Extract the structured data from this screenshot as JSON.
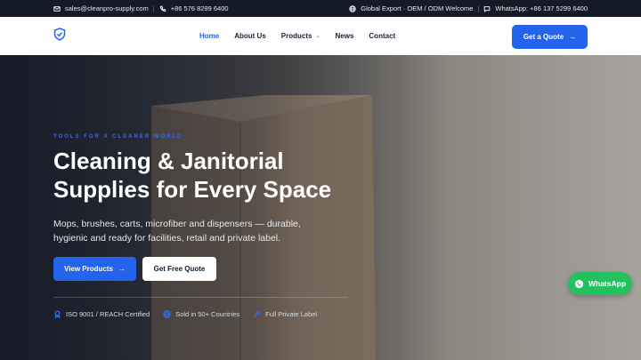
{
  "topbar": {
    "email": "sales@cleanpro-supply.com",
    "separator": "|",
    "phone": "+86 576 8299 6400",
    "export_note": "Global Export · OEM / ODM Welcome",
    "whatsapp": "WhatsApp: +86 137 5299 6400"
  },
  "nav": {
    "items": [
      {
        "label": "Home",
        "active": true
      },
      {
        "label": "About Us"
      },
      {
        "label": "Products",
        "has_dropdown": true
      },
      {
        "label": "News"
      },
      {
        "label": "Contact"
      }
    ],
    "cta": "Get a Quote"
  },
  "hero": {
    "eyebrow": "TOOLS FOR A CLEANER WORLD",
    "title_line1": "Cleaning & Janitorial",
    "title_line2": "Supplies for Every Space",
    "subtitle": "Mops, brushes, carts, microfiber and dispensers — durable, hygienic and ready for facilities, retail and private label.",
    "primary_button": "View Products",
    "secondary_button": "Get Free Quote",
    "badges": [
      {
        "icon": "award-icon",
        "label": "ISO 9001 / REACH Certified"
      },
      {
        "icon": "globe-icon",
        "label": "Sold in 50+ Countries"
      },
      {
        "icon": "pin-icon",
        "label": "Full Private Label"
      }
    ]
  },
  "whatsapp_button": "WhatsApp",
  "colors": {
    "accent": "#2463eb",
    "topbar": "#151a27",
    "whatsapp": "#25c15f"
  }
}
